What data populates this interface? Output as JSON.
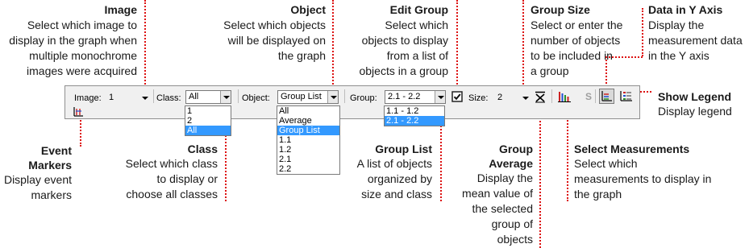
{
  "annotations": {
    "image": {
      "title": "Image",
      "desc": [
        "Select which image to",
        "display in the graph when",
        "multiple monochrome",
        "images were acquired"
      ]
    },
    "object": {
      "title": "Object",
      "desc": [
        "Select which objects",
        "will be displayed on",
        "the graph"
      ]
    },
    "edit_group": {
      "title": "Edit Group",
      "desc": [
        "Select which",
        "objects to display",
        "from a list of",
        "objects in a group"
      ]
    },
    "group_size": {
      "title": "Group Size",
      "desc": [
        "Select or enter the",
        "number of objects",
        "to be included in",
        "a group"
      ]
    },
    "data_y_axis": {
      "title": "Data in Y Axis",
      "desc": [
        "Display the",
        "measurement data",
        "in the Y axis"
      ]
    },
    "show_legend": {
      "title": "Show Legend",
      "desc": [
        "Display legend"
      ]
    },
    "event_markers": {
      "title": [
        "Event",
        "Markers"
      ],
      "desc": [
        "Display event",
        "markers"
      ]
    },
    "class": {
      "title": "Class",
      "desc": [
        "Select which class",
        "to display or",
        "choose all classes"
      ]
    },
    "group_list": {
      "title": "Group List",
      "desc": [
        "A list of objects",
        "organized by",
        "size and class"
      ]
    },
    "group_average": {
      "title": [
        "Group",
        "Average"
      ],
      "desc": [
        "Display the",
        "mean value of",
        "the selected",
        "group of",
        "objects"
      ]
    },
    "select_measurements": {
      "title": "Select Measurements",
      "desc": [
        "Select which",
        "measurements to display in",
        "the graph"
      ]
    }
  },
  "toolbar": {
    "image_label": "Image:",
    "image_value": "1",
    "class_label": "Class:",
    "class_value": "All",
    "object_label": "Object:",
    "object_value": "Group List",
    "group_label": "Group:",
    "group_value": "2.1 - 2.2",
    "size_label": "Size:",
    "size_value": "2",
    "s_label": "S"
  },
  "class_dropdown": [
    "1",
    "2",
    "All"
  ],
  "class_dropdown_selected": "All",
  "object_dropdown": [
    "All",
    "Average",
    "Group List",
    "1.1",
    "1.2",
    "2.1",
    "2.2"
  ],
  "object_dropdown_selected": "Group List",
  "group_dropdown": [
    "1.1 - 1.2",
    "2.1 - 2.2"
  ],
  "group_dropdown_selected": "2.1 - 2.2",
  "icons": {
    "edit_group": "checkbox-icon",
    "group_average": "x-bar-icon",
    "select_measurements": "measurement-bars-icon",
    "s_button": "s-icon",
    "data_y_axis": "y-axis-data-icon",
    "show_legend": "legend-icon",
    "event_markers": "event-marker-icon"
  },
  "colors": {
    "callout_line": "#dd1111",
    "selection": "#3399ff",
    "toolbar_bg": "#f0f0f0"
  }
}
